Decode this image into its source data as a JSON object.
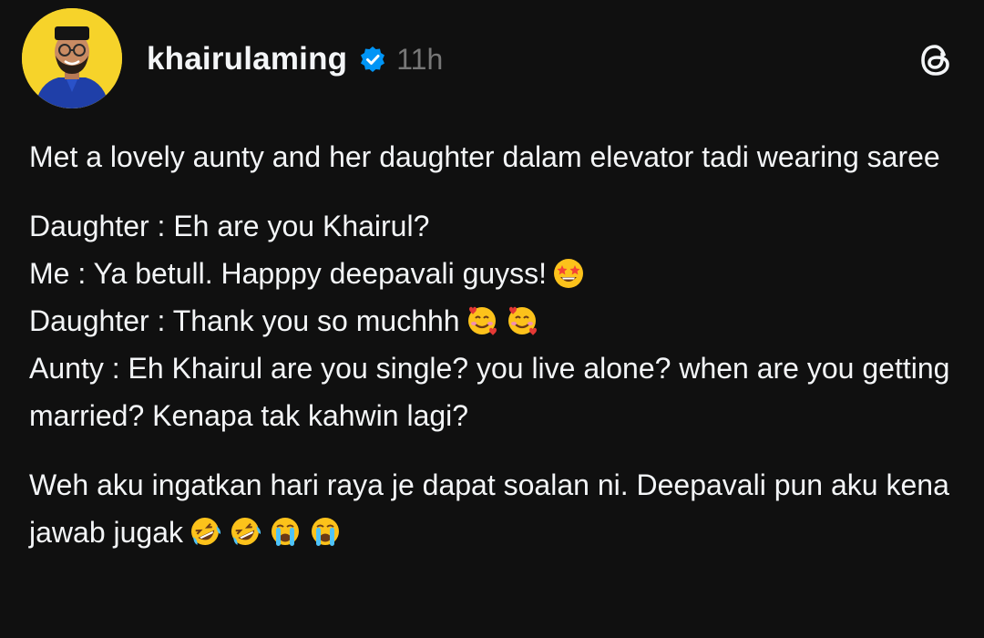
{
  "post": {
    "username": "khairulaming",
    "timestamp": "11h",
    "para1": "Met a lovely aunty and her daughter dalam elevator tadi wearing saree",
    "dialog": [
      {
        "text": "Daughter : Eh are you Khairul?",
        "emojis": []
      },
      {
        "text": "Me : Ya betull. Happpy deepavali guyss!",
        "emojis": [
          "star-struck-icon"
        ]
      },
      {
        "text": "Daughter : Thank you so muchhh",
        "emojis": [
          "smiling-face-with-hearts-icon",
          "smiling-face-with-hearts-icon"
        ]
      },
      {
        "text": "Aunty : Eh Khairul are you single? you live alone? when are you getting married? Kenapa tak kahwin lagi?",
        "emojis": []
      }
    ],
    "para3": "Weh aku ingatkan hari raya je dapat soalan ni. Deepavali pun aku kena jawab jugak",
    "para3_emojis": [
      "rolling-on-floor-laughing-icon",
      "rolling-on-floor-laughing-icon",
      "loudly-crying-face-icon",
      "loudly-crying-face-icon"
    ]
  },
  "colors": {
    "background": "#101010",
    "text": "#f3f5f7",
    "muted": "#777777",
    "verified": "#0095f6",
    "avatar_bg": "#f6d32a"
  }
}
